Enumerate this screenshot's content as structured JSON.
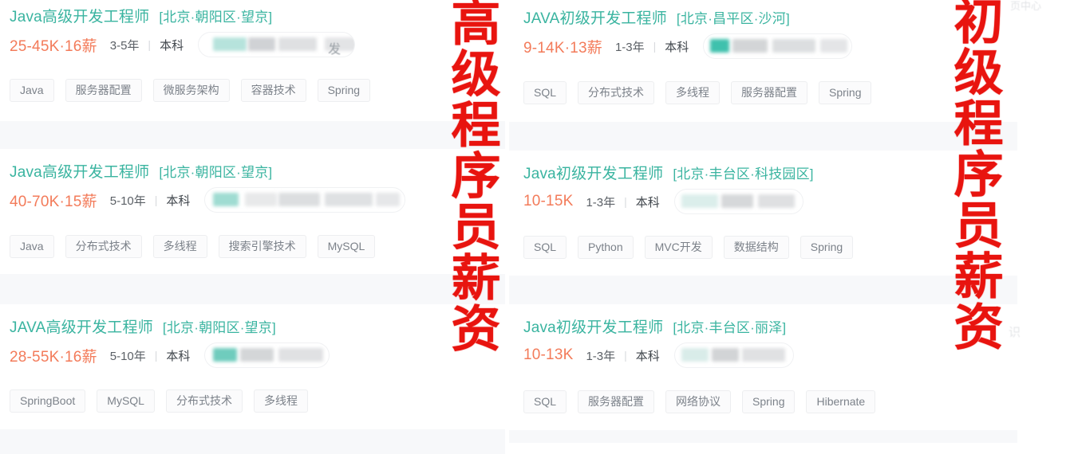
{
  "annotations": {
    "left": "高级程序员薪资",
    "right": "初级程序员薪资"
  },
  "background_chrome": {
    "top_right_partial": "页中心",
    "side_partial": "识"
  },
  "colors": {
    "title": "#3ab4a0",
    "salary": "#f37b5a",
    "annotation_red": "#e8140f",
    "tag_text": "#7c828a",
    "page_bg": "#f7f8fa",
    "card_bg": "#ffffff"
  },
  "divider": "|",
  "left_column": {
    "heading": "高级程序员薪资",
    "cards": [
      {
        "title": "Java高级开发工程师",
        "location": "[北京·朝阳区·望京]",
        "salary": "25-45K·16薪",
        "experience": "3-5年",
        "education": "本科",
        "company": "",
        "company_partial_glyph": "发",
        "tags": [
          "Java",
          "服务器配置",
          "微服务架构",
          "容器技术",
          "Spring"
        ]
      },
      {
        "title": "Java高级开发工程师",
        "location": "[北京·朝阳区·望京]",
        "salary": "40-70K·15薪",
        "experience": "5-10年",
        "education": "本科",
        "company": "",
        "company_partial_glyph": "",
        "tags": [
          "Java",
          "分布式技术",
          "多线程",
          "搜索引擎技术",
          "MySQL"
        ]
      },
      {
        "title": "JAVA高级开发工程师",
        "location": "[北京·朝阳区·望京]",
        "salary": "28-55K·16薪",
        "experience": "5-10年",
        "education": "本科",
        "company": "",
        "company_partial_glyph": "",
        "tags": [
          "SpringBoot",
          "MySQL",
          "分布式技术",
          "多线程"
        ]
      }
    ]
  },
  "right_column": {
    "heading": "初级程序员薪资",
    "cards": [
      {
        "title": "JAVA初级开发工程师",
        "location": "[北京·昌平区·沙河]",
        "salary": "9-14K·13薪",
        "experience": "1-3年",
        "education": "本科",
        "company": "",
        "company_partial_glyph": "",
        "tags": [
          "SQL",
          "分布式技术",
          "多线程",
          "服务器配置",
          "Spring"
        ]
      },
      {
        "title": "Java初级开发工程师",
        "location": "[北京·丰台区·科技园区]",
        "salary": "10-15K",
        "experience": "1-3年",
        "education": "本科",
        "company": "",
        "company_partial_glyph": "",
        "tags": [
          "SQL",
          "Python",
          "MVC开发",
          "数据结构",
          "Spring"
        ]
      },
      {
        "title": "Java初级开发工程师",
        "location": "[北京·丰台区·丽泽]",
        "salary": "10-13K",
        "experience": "1-3年",
        "education": "本科",
        "company": "",
        "company_partial_glyph": "",
        "tags": [
          "SQL",
          "服务器配置",
          "网络协议",
          "Spring",
          "Hibernate"
        ]
      }
    ]
  }
}
